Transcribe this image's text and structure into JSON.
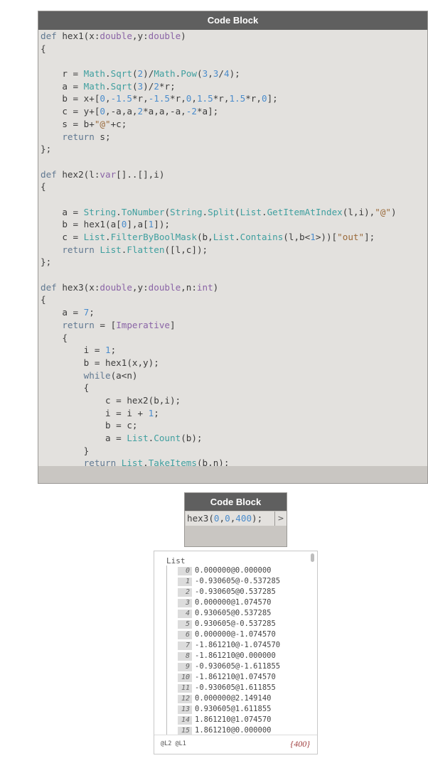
{
  "node1": {
    "title": "Code Block",
    "code_lines": [
      [
        [
          "kw",
          "def"
        ],
        [
          "op",
          " hex1(x:"
        ],
        [
          "ty",
          "double"
        ],
        [
          "op",
          ",y:"
        ],
        [
          "ty",
          "double"
        ],
        [
          "op",
          ")"
        ]
      ],
      [
        [
          "op",
          "{"
        ]
      ],
      [
        [
          "op",
          ""
        ]
      ],
      [
        [
          "op",
          "    r = "
        ],
        [
          "fn",
          "Math"
        ],
        [
          "op",
          "."
        ],
        [
          "fn",
          "Sqrt"
        ],
        [
          "op",
          "("
        ],
        [
          "num",
          "2"
        ],
        [
          "op",
          ")/"
        ],
        [
          "fn",
          "Math"
        ],
        [
          "op",
          "."
        ],
        [
          "fn",
          "Pow"
        ],
        [
          "op",
          "("
        ],
        [
          "num",
          "3"
        ],
        [
          "op",
          ","
        ],
        [
          "num",
          "3"
        ],
        [
          "op",
          "/"
        ],
        [
          "num",
          "4"
        ],
        [
          "op",
          ");"
        ]
      ],
      [
        [
          "op",
          "    a = "
        ],
        [
          "fn",
          "Math"
        ],
        [
          "op",
          "."
        ],
        [
          "fn",
          "Sqrt"
        ],
        [
          "op",
          "("
        ],
        [
          "num",
          "3"
        ],
        [
          "op",
          ")/"
        ],
        [
          "num",
          "2"
        ],
        [
          "op",
          "*r;"
        ]
      ],
      [
        [
          "op",
          "    b = x+["
        ],
        [
          "num",
          "0"
        ],
        [
          "op",
          ","
        ],
        [
          "num",
          "-1.5"
        ],
        [
          "op",
          "*r,"
        ],
        [
          "num",
          "-1.5"
        ],
        [
          "op",
          "*r,"
        ],
        [
          "num",
          "0"
        ],
        [
          "op",
          ","
        ],
        [
          "num",
          "1.5"
        ],
        [
          "op",
          "*r,"
        ],
        [
          "num",
          "1.5"
        ],
        [
          "op",
          "*r,"
        ],
        [
          "num",
          "0"
        ],
        [
          "op",
          "];"
        ]
      ],
      [
        [
          "op",
          "    c = y+["
        ],
        [
          "num",
          "0"
        ],
        [
          "op",
          ",-a,a,"
        ],
        [
          "num",
          "2"
        ],
        [
          "op",
          "*a,a,-a,"
        ],
        [
          "num",
          "-2"
        ],
        [
          "op",
          "*a];"
        ]
      ],
      [
        [
          "op",
          "    s = b+"
        ],
        [
          "str",
          "\"@\""
        ],
        [
          "op",
          "+c;"
        ]
      ],
      [
        [
          "op",
          "    "
        ],
        [
          "kw",
          "return"
        ],
        [
          "op",
          " s;"
        ]
      ],
      [
        [
          "op",
          "};"
        ]
      ],
      [
        [
          "op",
          ""
        ]
      ],
      [
        [
          "kw",
          "def"
        ],
        [
          "op",
          " hex2(l:"
        ],
        [
          "ty",
          "var"
        ],
        [
          "op",
          "[]..[],i)"
        ]
      ],
      [
        [
          "op",
          "{"
        ]
      ],
      [
        [
          "op",
          ""
        ]
      ],
      [
        [
          "op",
          "    a = "
        ],
        [
          "fn",
          "String"
        ],
        [
          "op",
          "."
        ],
        [
          "fn",
          "ToNumber"
        ],
        [
          "op",
          "("
        ],
        [
          "fn",
          "String"
        ],
        [
          "op",
          "."
        ],
        [
          "fn",
          "Split"
        ],
        [
          "op",
          "("
        ],
        [
          "fn",
          "List"
        ],
        [
          "op",
          "."
        ],
        [
          "fn",
          "GetItemAtIndex"
        ],
        [
          "op",
          "(l,i),"
        ],
        [
          "str",
          "\"@\""
        ],
        [
          "op",
          ")"
        ]
      ],
      [
        [
          "op",
          "    b = hex1(a["
        ],
        [
          "num",
          "0"
        ],
        [
          "op",
          "],a["
        ],
        [
          "num",
          "1"
        ],
        [
          "op",
          "]);"
        ]
      ],
      [
        [
          "op",
          "    c = "
        ],
        [
          "fn",
          "List"
        ],
        [
          "op",
          "."
        ],
        [
          "fn",
          "FilterByBoolMask"
        ],
        [
          "op",
          "(b,"
        ],
        [
          "fn",
          "List"
        ],
        [
          "op",
          "."
        ],
        [
          "fn",
          "Contains"
        ],
        [
          "op",
          "(l,b<"
        ],
        [
          "num",
          "1"
        ],
        [
          "op",
          ">))["
        ],
        [
          "str",
          "\"out\""
        ],
        [
          "op",
          "];"
        ]
      ],
      [
        [
          "op",
          "    "
        ],
        [
          "kw",
          "return"
        ],
        [
          "op",
          " "
        ],
        [
          "fn",
          "List"
        ],
        [
          "op",
          "."
        ],
        [
          "fn",
          "Flatten"
        ],
        [
          "op",
          "([l,c]);"
        ]
      ],
      [
        [
          "op",
          "};"
        ]
      ],
      [
        [
          "op",
          ""
        ]
      ],
      [
        [
          "kw",
          "def"
        ],
        [
          "op",
          " hex3(x:"
        ],
        [
          "ty",
          "double"
        ],
        [
          "op",
          ",y:"
        ],
        [
          "ty",
          "double"
        ],
        [
          "op",
          ",n:"
        ],
        [
          "ty",
          "int"
        ],
        [
          "op",
          ")"
        ]
      ],
      [
        [
          "op",
          "{"
        ]
      ],
      [
        [
          "op",
          "    a = "
        ],
        [
          "num",
          "7"
        ],
        [
          "op",
          ";"
        ]
      ],
      [
        [
          "op",
          "    "
        ],
        [
          "kw",
          "return"
        ],
        [
          "op",
          " = ["
        ],
        [
          "ty",
          "Imperative"
        ],
        [
          "op",
          "]"
        ]
      ],
      [
        [
          "op",
          "    {"
        ]
      ],
      [
        [
          "op",
          "        i = "
        ],
        [
          "num",
          "1"
        ],
        [
          "op",
          ";"
        ]
      ],
      [
        [
          "op",
          "        b = hex1(x,y);"
        ]
      ],
      [
        [
          "op",
          "        "
        ],
        [
          "kw",
          "while"
        ],
        [
          "op",
          "(a<n)"
        ]
      ],
      [
        [
          "op",
          "        {"
        ]
      ],
      [
        [
          "op",
          "            c = hex2(b,i);"
        ]
      ],
      [
        [
          "op",
          "            i = i + "
        ],
        [
          "num",
          "1"
        ],
        [
          "op",
          ";"
        ]
      ],
      [
        [
          "op",
          "            b = c;"
        ]
      ],
      [
        [
          "op",
          "            a = "
        ],
        [
          "fn",
          "List"
        ],
        [
          "op",
          "."
        ],
        [
          "fn",
          "Count"
        ],
        [
          "op",
          "(b);"
        ]
      ],
      [
        [
          "op",
          "        }"
        ]
      ],
      [
        [
          "op",
          "        "
        ],
        [
          "kw",
          "return"
        ],
        [
          "op",
          " "
        ],
        [
          "fn",
          "List"
        ],
        [
          "op",
          "."
        ],
        [
          "fn",
          "TakeItems"
        ],
        [
          "op",
          "(b,n);"
        ]
      ],
      [
        [
          "op",
          "    }"
        ]
      ],
      [
        [
          "op",
          "};"
        ]
      ]
    ]
  },
  "node2": {
    "title": "Code Block",
    "code": [
      [
        "op",
        "hex3("
      ],
      [
        "num",
        "0"
      ],
      [
        "op",
        ","
      ],
      [
        "num",
        "0"
      ],
      [
        "op",
        ","
      ],
      [
        "num",
        "400"
      ],
      [
        "op",
        ");"
      ]
    ],
    "out_port": ">"
  },
  "preview": {
    "list_title": "List",
    "items": [
      {
        "i": "0",
        "v": "0.000000@0.000000"
      },
      {
        "i": "1",
        "v": "-0.930605@-0.537285"
      },
      {
        "i": "2",
        "v": "-0.930605@0.537285"
      },
      {
        "i": "3",
        "v": "0.000000@1.074570"
      },
      {
        "i": "4",
        "v": "0.930605@0.537285"
      },
      {
        "i": "5",
        "v": "0.930605@-0.537285"
      },
      {
        "i": "6",
        "v": "0.000000@-1.074570"
      },
      {
        "i": "7",
        "v": "-1.861210@-1.074570"
      },
      {
        "i": "8",
        "v": "-1.861210@0.000000"
      },
      {
        "i": "9",
        "v": "-0.930605@-1.611855"
      },
      {
        "i": "10",
        "v": "-1.861210@1.074570"
      },
      {
        "i": "11",
        "v": "-0.930605@1.611855"
      },
      {
        "i": "12",
        "v": "0.000000@2.149140"
      },
      {
        "i": "13",
        "v": "0.930605@1.611855"
      },
      {
        "i": "14",
        "v": "1.861210@1.074570"
      },
      {
        "i": "15",
        "v": "1.861210@0.000000"
      }
    ],
    "levels": "@L2 @L1",
    "count": "{400}"
  },
  "colors": {
    "header": "#5f5f5f",
    "node_body": "#e3e1de",
    "keyword": "#607891",
    "type": "#8a64a6",
    "function": "#3f9f9f",
    "number": "#4a8ccc",
    "string": "#9a6a3a"
  }
}
